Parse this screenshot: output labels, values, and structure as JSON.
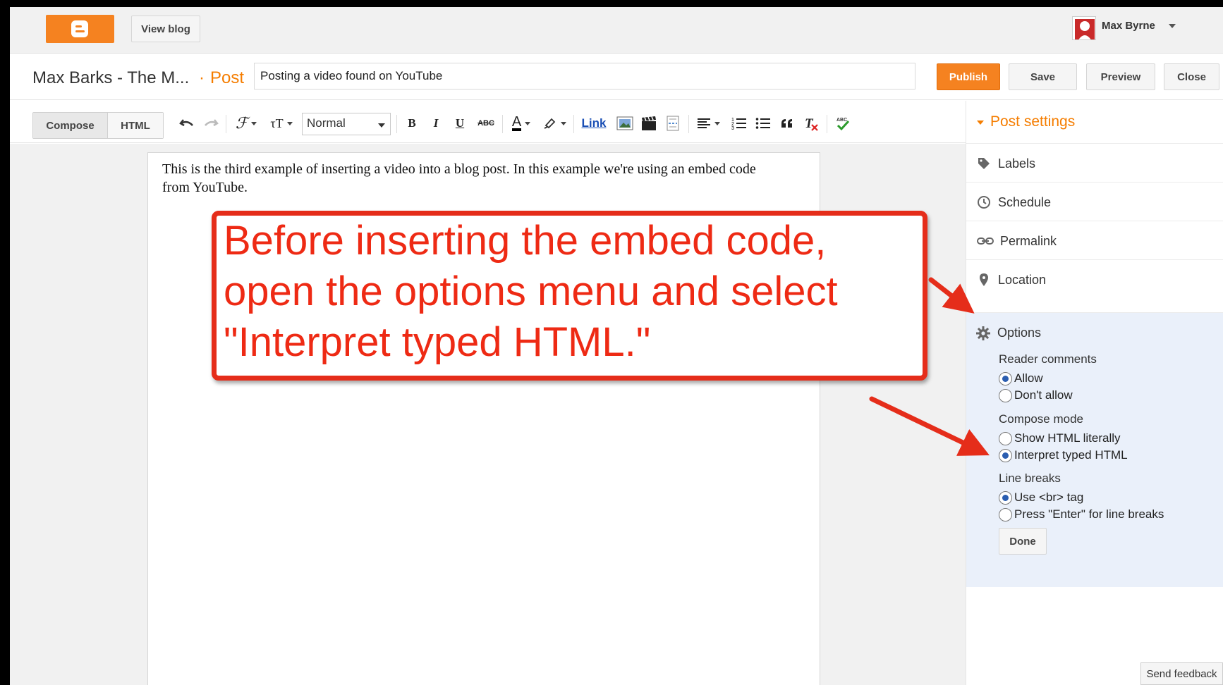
{
  "topbar": {
    "view_blog_label": "View blog",
    "user_name": "Max Byrne"
  },
  "titlebar": {
    "blog_title": "Max Barks - The M...",
    "separator": "·",
    "post_crumb": "Post",
    "post_title_value": "Posting a video found on YouTube",
    "publish_label": "Publish",
    "save_label": "Save",
    "preview_label": "Preview",
    "close_label": "Close"
  },
  "toolbar": {
    "tab_compose": "Compose",
    "tab_html": "HTML",
    "format_value": "Normal",
    "link_label": "Link",
    "bold_glyph": "B",
    "italic_glyph": "I",
    "underline_glyph": "U",
    "strike_glyph": "ABC",
    "textcolor_glyph": "A"
  },
  "editor": {
    "body_text": "This is the third example of inserting a video into a blog post. In this example we're using an embed code from YouTube."
  },
  "sidebar": {
    "title": "Post settings",
    "items": [
      {
        "label": "Labels",
        "icon": "tag-icon"
      },
      {
        "label": "Schedule",
        "icon": "clock-icon"
      },
      {
        "label": "Permalink",
        "icon": "link-icon"
      },
      {
        "label": "Location",
        "icon": "pin-icon"
      }
    ],
    "options": {
      "label": "Options",
      "reader_comments": {
        "heading": "Reader comments",
        "choices": [
          "Allow",
          "Don't allow"
        ],
        "selected": "Allow"
      },
      "compose_mode": {
        "heading": "Compose mode",
        "choices": [
          "Show HTML literally",
          "Interpret typed HTML"
        ],
        "selected": "Interpret typed HTML"
      },
      "line_breaks": {
        "heading": "Line breaks",
        "choices": [
          "Use <br> tag",
          "Press \"Enter\" for line breaks"
        ],
        "selected": "Use <br> tag"
      },
      "done_label": "Done"
    }
  },
  "feedback_label": "Send feedback",
  "callout": {
    "text": "Before inserting the embed code, open the options menu and select \"Interpret typed HTML.\"",
    "color": "#ee2a14"
  },
  "colors": {
    "accent_orange": "#f58220",
    "panel_blue": "#eaf0fa",
    "annotation_red": "#e52d1a"
  }
}
